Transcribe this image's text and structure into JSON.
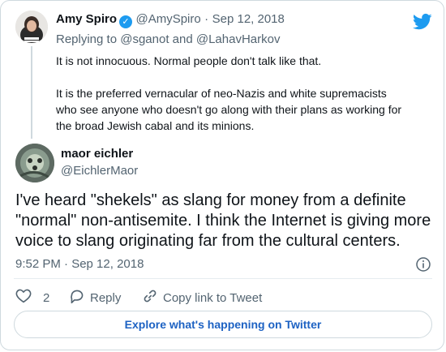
{
  "quoted": {
    "name": "Amy Spiro",
    "handle": "@AmySpiro",
    "separator": "·",
    "date": "Sep 12, 2018",
    "replying_prefix": "Replying to",
    "replying_handles": "@sganot and @LahavHarkov",
    "para1": "It is not innocuous. Normal people don't talk like that.",
    "para2_line1": "It is the preferred vernacular of neo-Nazis and white supremacists",
    "para2_line2": "who see anyone who doesn't go along with their plans as working for",
    "para2_line3": "the broad Jewish cabal and its minions."
  },
  "main": {
    "name": "maor eichler",
    "handle": "@EichlerMaor",
    "text_line1": "I've heard \"shekels\" as slang for money from a definite",
    "text_line2": "\"normal\" non-antisemite. I think the Internet is giving more",
    "text_line3": "voice to slang originating far from the cultural centers.",
    "time": "9:52 PM · Sep 12, 2018"
  },
  "actions": {
    "likes": "2",
    "reply_label": "Reply",
    "copy_label": "Copy link to Tweet"
  },
  "explore_label": "Explore what's happening on Twitter",
  "colors": {
    "accent": "#1d9bf0",
    "muted": "#536471",
    "button_text": "#1d62c3"
  }
}
